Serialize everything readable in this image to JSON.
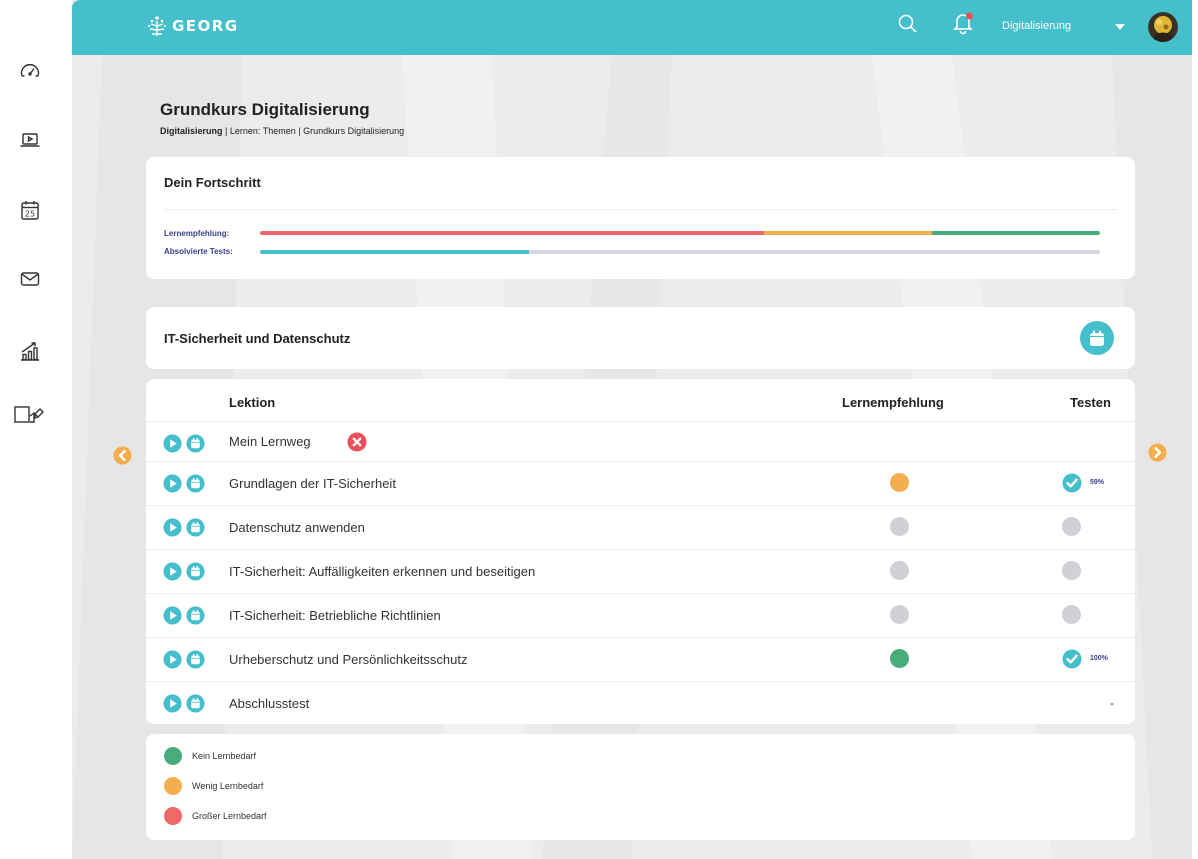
{
  "header": {
    "logo_text": "GEORG",
    "user_name": "Digitalisierung"
  },
  "page": {
    "title": "Grundkurs Digitalisierung",
    "breadcrumb": {
      "first": "Digitalisierung",
      "sep1": " | ",
      "second": "Lernen: Themen",
      "sep2": " | ",
      "third": "Grundkurs Digitalisierung"
    }
  },
  "progress": {
    "title": "Dein Fortschritt",
    "rec_label": "Lernempfehlung:",
    "tests_label": "Absolvierte Tests:",
    "rec_segments": [
      {
        "fraction": 0.6,
        "color": "#ef6868"
      },
      {
        "fraction": 0.2,
        "color": "#f4ad4f"
      },
      {
        "fraction": 0.2,
        "color": "#48ad7b"
      }
    ],
    "tests_fraction": 0.32,
    "tests_color": "#45bfcb",
    "tests_rest_color": "#d5d8e2"
  },
  "topic": {
    "title": "IT-Sicherheit und Datenschutz"
  },
  "lessons": {
    "headers": {
      "lesson": "Lektion",
      "recommendation": "Lernempfehlung",
      "test": "Testen"
    },
    "rows": [
      {
        "label": "Mein Lernweg",
        "remove": true,
        "rec": null,
        "test": null
      },
      {
        "label": "Grundlagen der IT-Sicherheit",
        "rec": "#f4ad4f",
        "test": "check",
        "pct": "59%"
      },
      {
        "label": "Datenschutz anwenden",
        "rec": "#d1d0d6",
        "test": "dot"
      },
      {
        "label": "IT-Sicherheit: Auffälligkeiten erkennen und beseitigen",
        "rec": "#d1d0d6",
        "test": "dot"
      },
      {
        "label": "IT-Sicherheit: Betriebliche Richtlinien",
        "rec": "#d1d0d6",
        "test": "dot"
      },
      {
        "label": "Urheberschutz und Persönlichkeitsschutz",
        "rec": "#48ad7b",
        "test": "check",
        "pct": "100%"
      },
      {
        "label": "Abschlusstest",
        "rec": null,
        "test": "dash",
        "dash": "-"
      }
    ]
  },
  "legend": [
    {
      "label": "Kein Lernbedarf",
      "color": "#48ad7b"
    },
    {
      "label": "Wenig Lernbedarf",
      "color": "#f4ad4f"
    },
    {
      "label": "Großer Lernbedarf",
      "color": "#ef6868"
    }
  ],
  "colors": {
    "accent": "#45bfcb",
    "nav_arrow": "#f4ad4f",
    "remove": "#e8505b",
    "neutral_dot": "#d1d0d6",
    "label_blue": "#3b3f8f"
  },
  "icons": {
    "rail": [
      "speedometer-icon",
      "laptop-play-icon",
      "calendar-icon",
      "mail-icon",
      "chart-growth-icon",
      "devices-icon"
    ],
    "row_actions": [
      "play-icon",
      "calendar-icon"
    ]
  }
}
